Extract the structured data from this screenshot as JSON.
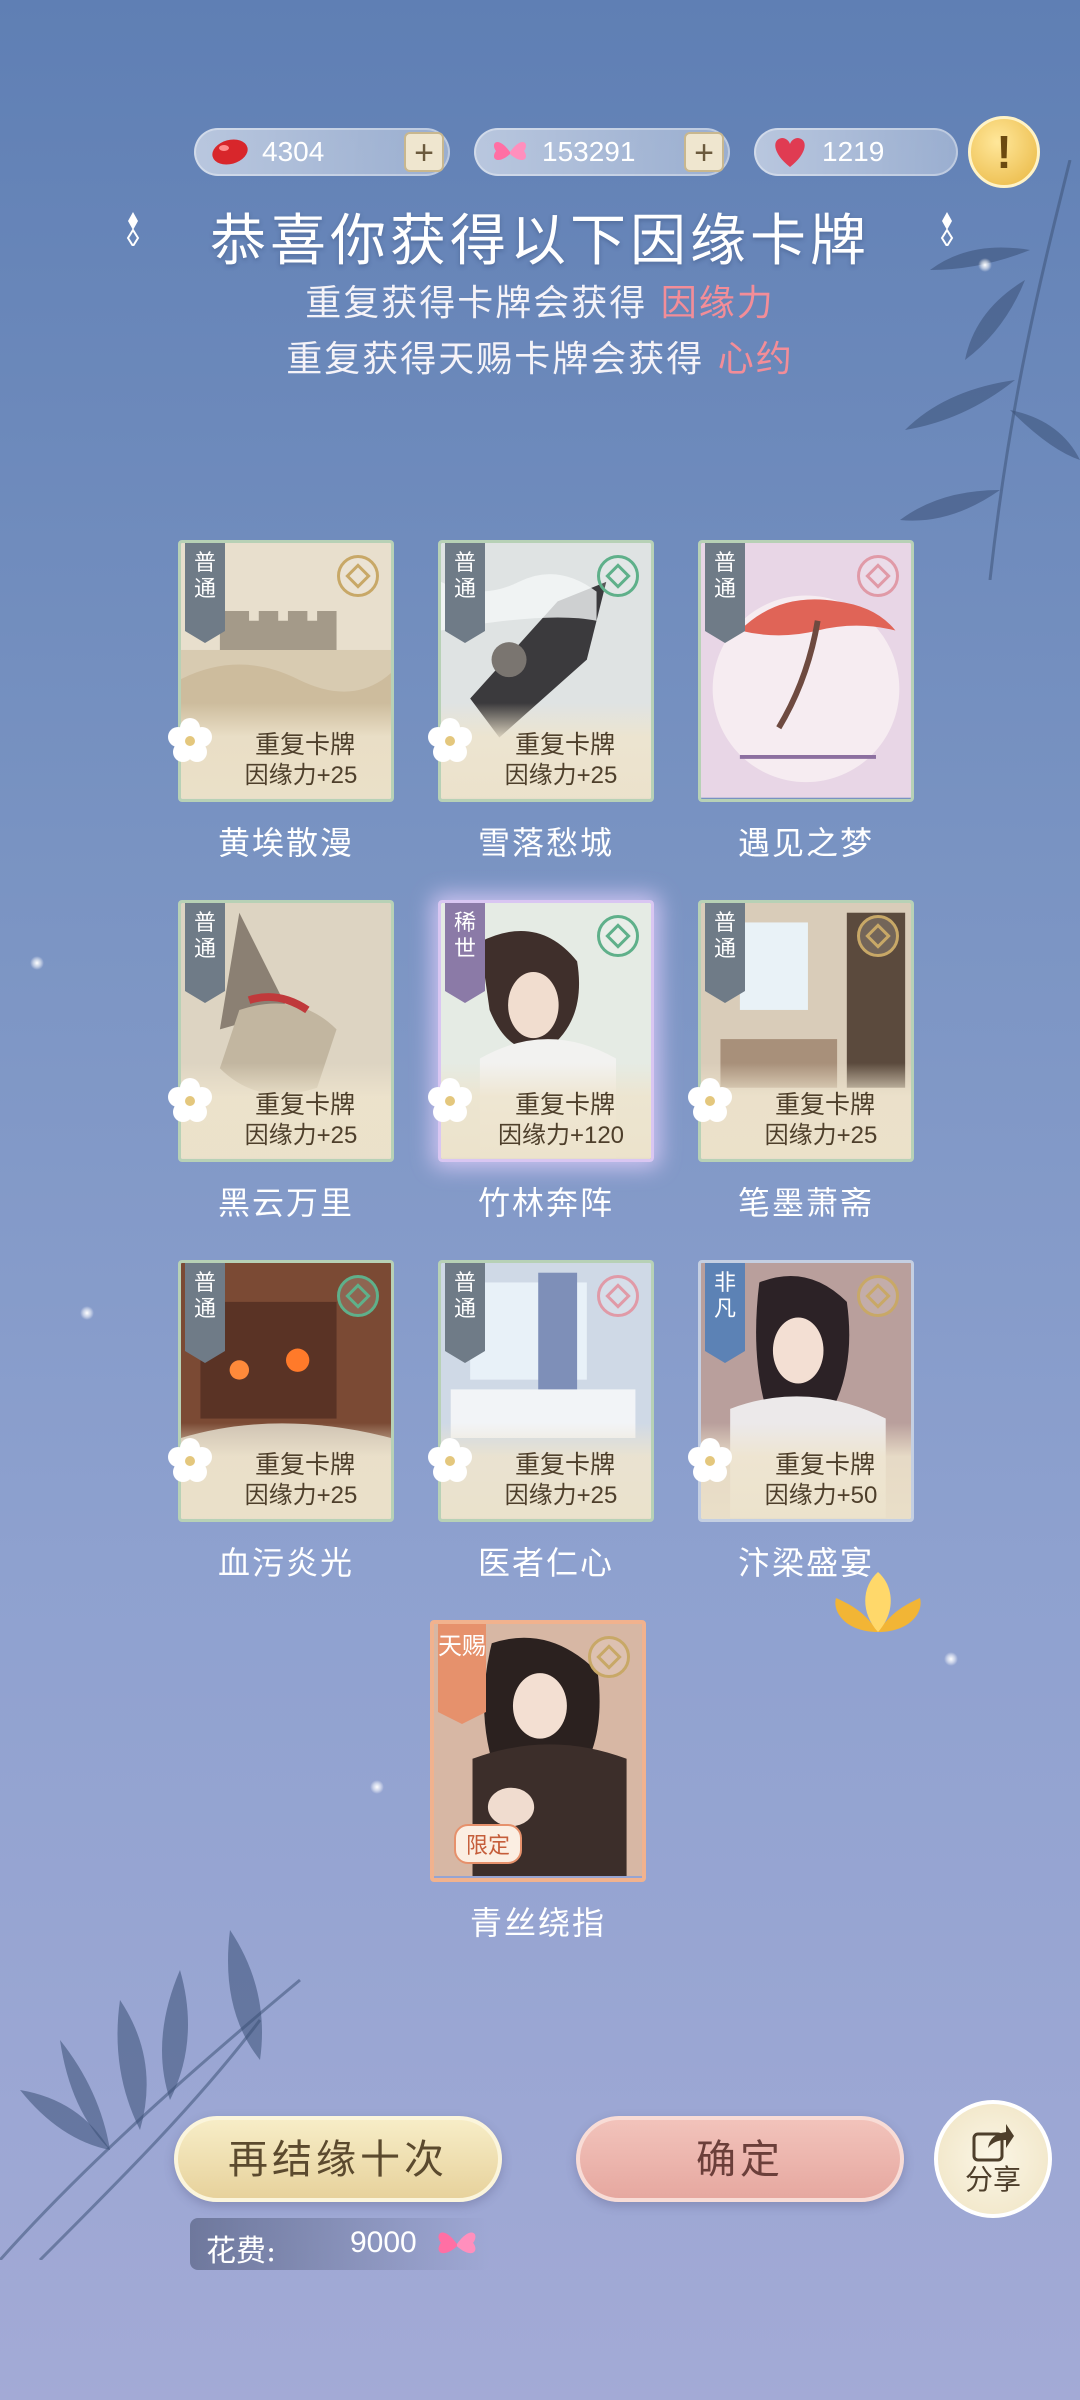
{
  "currencies": [
    {
      "name": "red-bean",
      "value": "4304",
      "has_plus": true
    },
    {
      "name": "butterfly",
      "value": "153291",
      "has_plus": true
    },
    {
      "name": "heart",
      "value": "1219",
      "has_plus": false
    }
  ],
  "header": {
    "title": "恭喜你获得以下因缘卡牌",
    "line1_prefix": "重复获得卡牌会获得",
    "line1_highlight": "因缘力",
    "line2_prefix": "重复获得天赐卡牌会获得",
    "line2_highlight": "心约"
  },
  "cards": [
    {
      "name": "黄埃散漫",
      "rarity": "普通",
      "dup_title": "重复卡牌",
      "dup_reward": "因缘力+25"
    },
    {
      "name": "雪落愁城",
      "rarity": "普通",
      "dup_title": "重复卡牌",
      "dup_reward": "因缘力+25"
    },
    {
      "name": "遇见之梦",
      "rarity": "普通"
    },
    {
      "name": "黑云万里",
      "rarity": "普通",
      "dup_title": "重复卡牌",
      "dup_reward": "因缘力+25"
    },
    {
      "name": "竹林奔阵",
      "rarity": "稀世",
      "dup_title": "重复卡牌",
      "dup_reward": "因缘力+120"
    },
    {
      "name": "笔墨萧斋",
      "rarity": "普通",
      "dup_title": "重复卡牌",
      "dup_reward": "因缘力+25"
    },
    {
      "name": "血污炎光",
      "rarity": "普通",
      "dup_title": "重复卡牌",
      "dup_reward": "因缘力+25"
    },
    {
      "name": "医者仁心",
      "rarity": "普通",
      "dup_title": "重复卡牌",
      "dup_reward": "因缘力+25"
    },
    {
      "name": "汴梁盛宴",
      "rarity": "非凡",
      "dup_title": "重复卡牌",
      "dup_reward": "因缘力+50"
    },
    {
      "name": "青丝绕指",
      "rarity": "天赐",
      "limited": "限定"
    }
  ],
  "actions": {
    "draw_ten": "再结缘十次",
    "confirm": "确定",
    "share": "分享",
    "cost_label": "花费:",
    "cost_value": "9000"
  },
  "colors": {
    "highlight": "#f38d98",
    "card_common_border": "#b7d1b6",
    "card_rare_glow": "#d9c6f2",
    "gift_border": "#f1b28e"
  }
}
